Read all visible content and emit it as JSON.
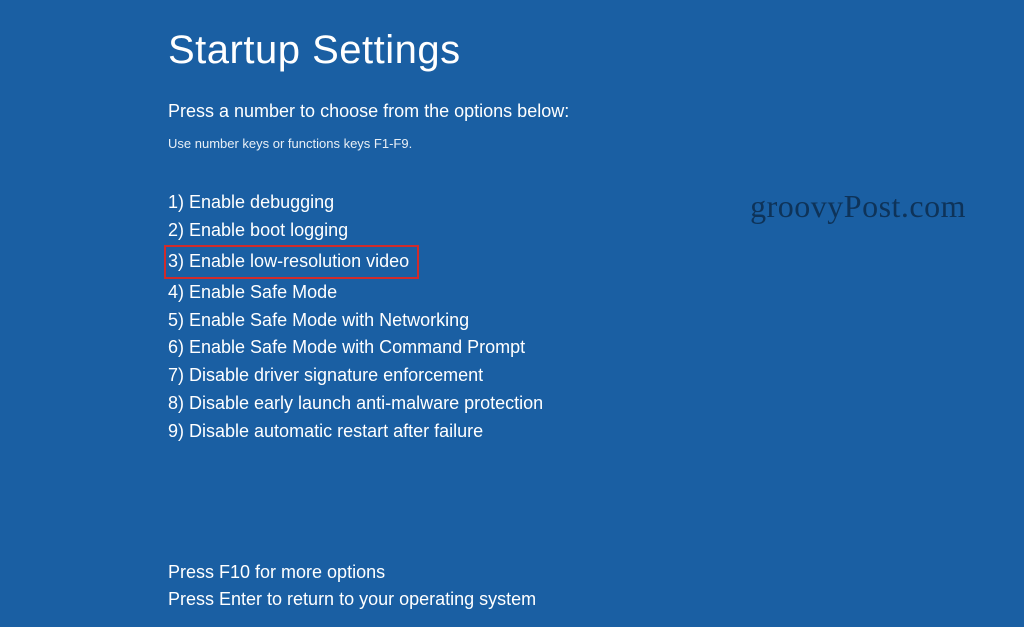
{
  "title": "Startup Settings",
  "subtitle": "Press a number to choose from the options below:",
  "hint": "Use number keys or functions keys F1-F9.",
  "options": [
    {
      "n": 1,
      "label": "Enable debugging",
      "highlighted": false
    },
    {
      "n": 2,
      "label": "Enable boot logging",
      "highlighted": false
    },
    {
      "n": 3,
      "label": "Enable low-resolution video",
      "highlighted": true
    },
    {
      "n": 4,
      "label": "Enable Safe Mode",
      "highlighted": false
    },
    {
      "n": 5,
      "label": "Enable Safe Mode with Networking",
      "highlighted": false
    },
    {
      "n": 6,
      "label": "Enable Safe Mode with Command Prompt",
      "highlighted": false
    },
    {
      "n": 7,
      "label": "Disable driver signature enforcement",
      "highlighted": false
    },
    {
      "n": 8,
      "label": "Disable early launch anti-malware protection",
      "highlighted": false
    },
    {
      "n": 9,
      "label": "Disable automatic restart after failure",
      "highlighted": false
    }
  ],
  "footer": {
    "line1": "Press F10 for more options",
    "line2": "Press Enter to return to your operating system"
  },
  "watermark": "groovyPost.com",
  "colors": {
    "background": "#1a5fa3",
    "highlight_border": "#d02b2b",
    "watermark_text": "#0e3359"
  }
}
